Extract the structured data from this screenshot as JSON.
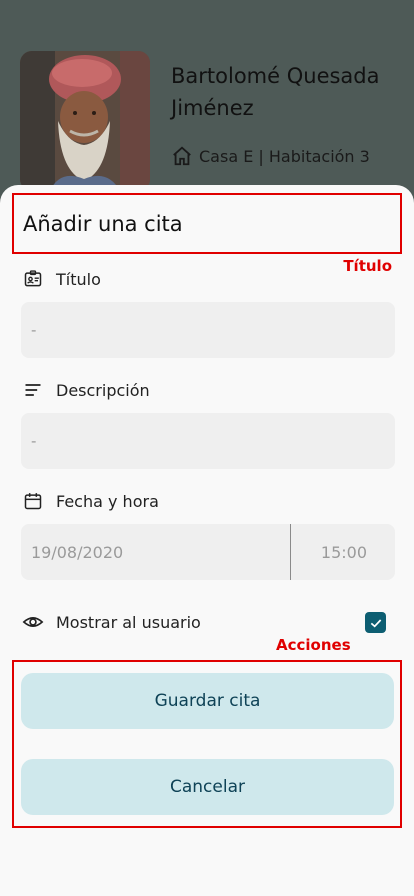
{
  "patient": {
    "name": "Bartolomé Quesada Jiménez",
    "location": "Casa E | Habitación 3"
  },
  "sheet": {
    "title": "Añadir una cita",
    "annotations": {
      "title": "Título",
      "actions": "Acciones"
    },
    "fields": {
      "titulo": {
        "label": "Título",
        "value": "-",
        "icon": "id-card-icon"
      },
      "descripcion": {
        "label": "Descripción",
        "value": "-",
        "icon": "lines-icon"
      },
      "fecha": {
        "label": "Fecha y hora",
        "date": "19/08/2020",
        "time": "15:00",
        "icon": "calendar-icon"
      },
      "mostrar": {
        "label": "Mostrar al usuario",
        "checked": true,
        "icon": "eye-icon"
      }
    },
    "buttons": {
      "save": "Guardar cita",
      "cancel": "Cancelar"
    }
  },
  "colors": {
    "accent": "#0d5e72",
    "button_bg": "#cfe8ec",
    "annotation": "#e00000",
    "overlay": "#4e5a57"
  }
}
